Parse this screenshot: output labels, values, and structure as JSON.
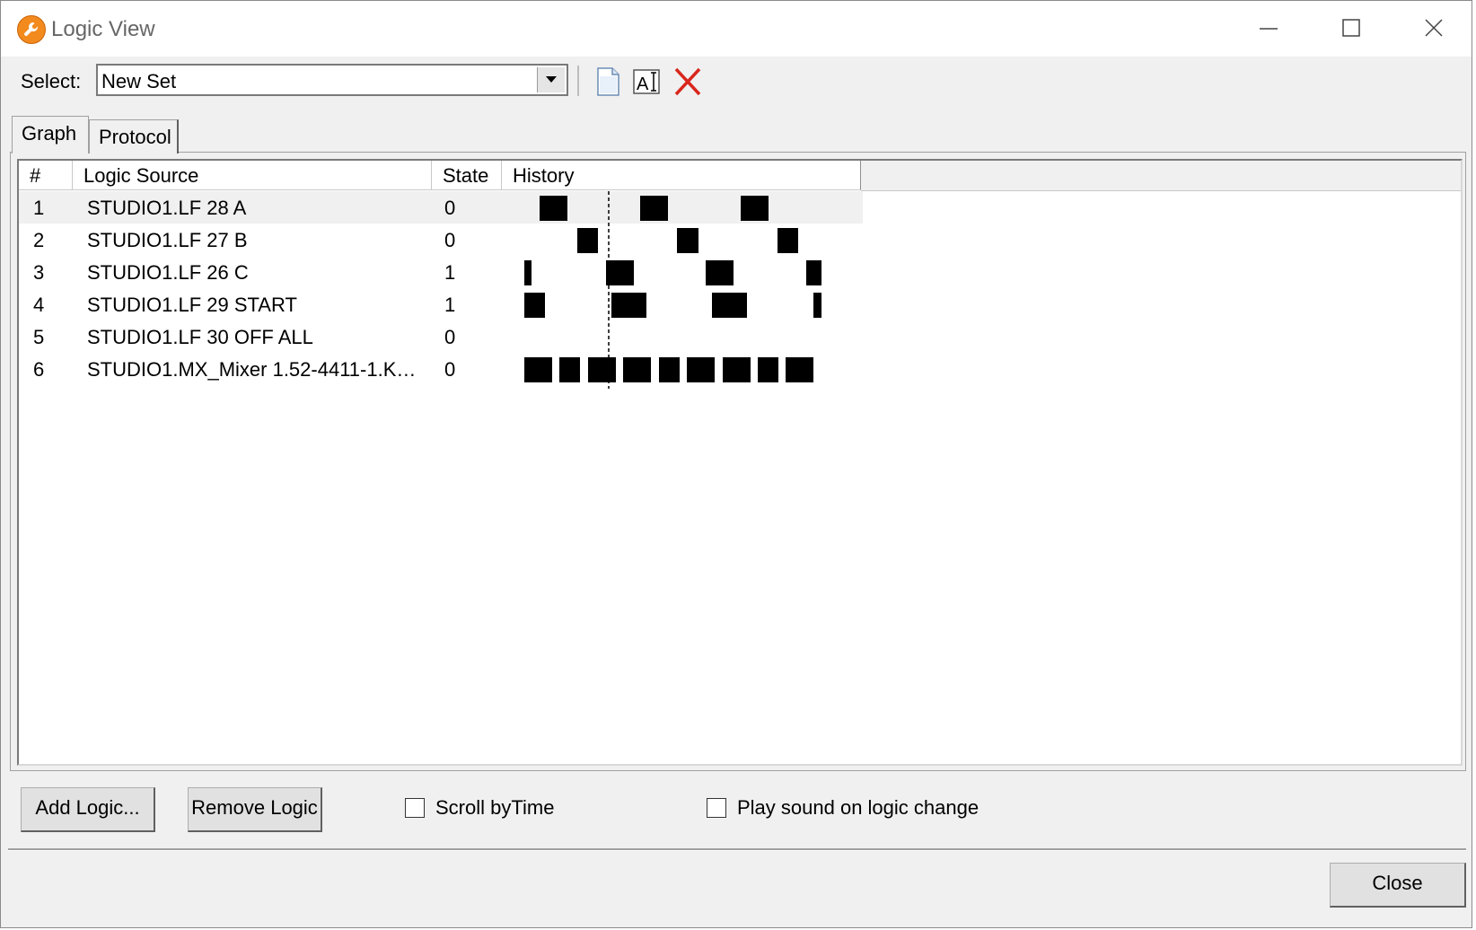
{
  "window": {
    "title": "Logic View"
  },
  "toolbar": {
    "select_label": "Select:",
    "select_value": "New Set",
    "new_icon": "new-document-icon",
    "rename_icon": "rename-icon",
    "delete_icon": "delete-icon",
    "delete_color": "#d9261c"
  },
  "tabs": [
    {
      "label": "Graph",
      "selected": true
    },
    {
      "label": "Protocol",
      "selected": false
    }
  ],
  "table": {
    "columns": [
      "#",
      "Logic Source",
      "State",
      "History"
    ],
    "rows": [
      {
        "num": "1",
        "source": "STUDIO1.LF 28 A",
        "state": "0"
      },
      {
        "num": "2",
        "source": "STUDIO1.LF 27 B",
        "state": "0"
      },
      {
        "num": "3",
        "source": "STUDIO1.LF 26 C",
        "state": "1"
      },
      {
        "num": "4",
        "source": "STUDIO1.LF 29 START",
        "state": "1"
      },
      {
        "num": "5",
        "source": "STUDIO1.LF 30 OFF ALL",
        "state": "0"
      },
      {
        "num": "6",
        "source": "STUDIO1.MX_Mixer 1.52-4411-1.Ke...",
        "state": "0"
      }
    ],
    "selected_row": 1
  },
  "buttons": {
    "add_logic": "Add Logic...",
    "remove_logic": "Remove Logic",
    "close": "Close"
  },
  "options": {
    "scroll_by_time": {
      "label": "Scroll byTime",
      "checked": false
    },
    "play_sound": {
      "label": "Play sound on logic change",
      "checked": false
    }
  }
}
